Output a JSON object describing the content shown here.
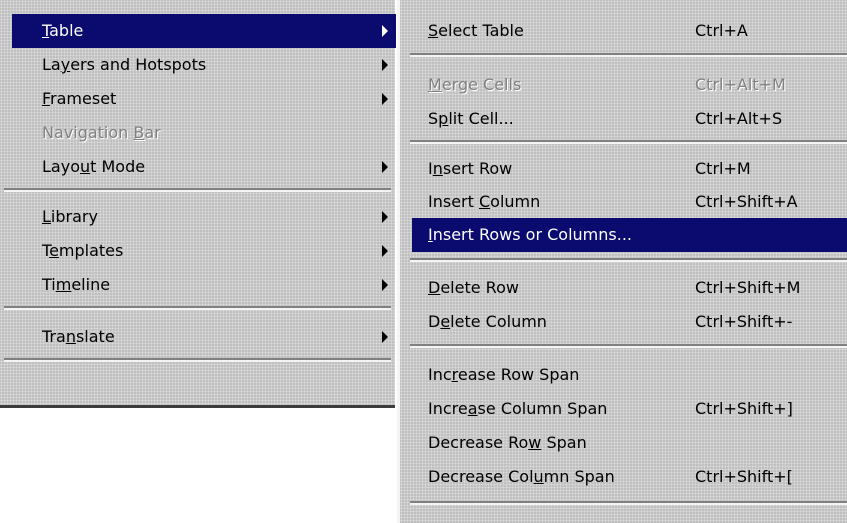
{
  "left_menu": {
    "items": [
      {
        "pre": "",
        "key": "T",
        "post": "able",
        "submenu": true,
        "highlighted": true,
        "disabled": false
      },
      {
        "pre": "La",
        "key": "y",
        "post": "ers and Hotspots",
        "submenu": true,
        "highlighted": false,
        "disabled": false
      },
      {
        "pre": "",
        "key": "F",
        "post": "rameset",
        "submenu": true,
        "highlighted": false,
        "disabled": false
      },
      {
        "pre": "Navigation ",
        "key": "B",
        "post": "ar",
        "submenu": false,
        "highlighted": false,
        "disabled": true
      },
      {
        "pre": "Layo",
        "key": "u",
        "post": "t Mode",
        "submenu": true,
        "highlighted": false,
        "disabled": false
      },
      {
        "pre": "",
        "key": "L",
        "post": "ibrary",
        "submenu": true,
        "highlighted": false,
        "disabled": false
      },
      {
        "pre": "T",
        "key": "e",
        "post": "mplates",
        "submenu": true,
        "highlighted": false,
        "disabled": false
      },
      {
        "pre": "Ti",
        "key": "m",
        "post": "eline",
        "submenu": true,
        "highlighted": false,
        "disabled": false
      },
      {
        "pre": "Tra",
        "key": "n",
        "post": "slate",
        "submenu": true,
        "highlighted": false,
        "disabled": false
      }
    ]
  },
  "right_menu": {
    "items": [
      {
        "pre": "",
        "key": "S",
        "post": "elect Table",
        "shortcut": "Ctrl+A",
        "highlighted": false,
        "disabled": false
      },
      {
        "pre": "",
        "key": "M",
        "post": "erge Cells",
        "shortcut": "Ctrl+Alt+M",
        "highlighted": false,
        "disabled": true
      },
      {
        "pre": "S",
        "key": "p",
        "post": "lit Cell...",
        "shortcut": "Ctrl+Alt+S",
        "highlighted": false,
        "disabled": false
      },
      {
        "pre": "I",
        "key": "n",
        "post": "sert Row",
        "shortcut": "Ctrl+M",
        "highlighted": false,
        "disabled": false
      },
      {
        "pre": "Insert ",
        "key": "C",
        "post": "olumn",
        "shortcut": "Ctrl+Shift+A",
        "highlighted": false,
        "disabled": false
      },
      {
        "pre": "",
        "key": "I",
        "post": "nsert Rows or Columns...",
        "shortcut": "",
        "highlighted": true,
        "disabled": false
      },
      {
        "pre": "",
        "key": "D",
        "post": "elete Row",
        "shortcut": "Ctrl+Shift+M",
        "highlighted": false,
        "disabled": false
      },
      {
        "pre": "D",
        "key": "e",
        "post": "lete Column",
        "shortcut": "Ctrl+Shift+-",
        "highlighted": false,
        "disabled": false
      },
      {
        "pre": "Inc",
        "key": "r",
        "post": "ease Row Span",
        "shortcut": "",
        "highlighted": false,
        "disabled": false
      },
      {
        "pre": "Incre",
        "key": "a",
        "post": "se Column Span",
        "shortcut": "Ctrl+Shift+]",
        "highlighted": false,
        "disabled": false
      },
      {
        "pre": "Decrease Ro",
        "key": "w",
        "post": " Span",
        "shortcut": "",
        "highlighted": false,
        "disabled": false
      },
      {
        "pre": "Decrease Col",
        "key": "u",
        "post": "mn Span",
        "shortcut": "Ctrl+Shift+[",
        "highlighted": false,
        "disabled": false
      }
    ]
  },
  "colors": {
    "menu_background": "#c0c0c0",
    "highlight": "#0a0a6f",
    "highlight_text": "#ffffff",
    "disabled_text": "#808080"
  }
}
